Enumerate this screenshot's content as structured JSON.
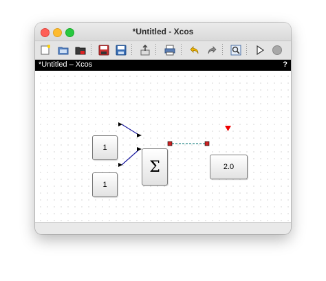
{
  "window": {
    "title": "*Untitled - Xcos"
  },
  "document": {
    "name": "*Untitled – Xcos",
    "help_label": "?"
  },
  "toolbar": {
    "buttons": [
      {
        "icon": "new-diagram-icon"
      },
      {
        "icon": "open-folder-icon"
      },
      {
        "icon": "open-file-icon"
      },
      {
        "icon": "save-icon"
      },
      {
        "icon": "save-as-icon"
      },
      {
        "icon": "export-icon"
      },
      {
        "icon": "print-icon"
      },
      {
        "icon": "undo-icon"
      },
      {
        "icon": "redo-icon"
      },
      {
        "icon": "zoom-fit-icon"
      },
      {
        "icon": "start-simulation-icon"
      },
      {
        "icon": "stop-simulation-icon"
      }
    ]
  },
  "diagram": {
    "blocks": {
      "const1": "1",
      "const2": "1",
      "sum": "Σ",
      "display": "2.0"
    }
  },
  "colors": {
    "data_link": "#1a1aa0",
    "activation_link": "#2a8a8a",
    "input_port": "#cc2222",
    "event_port": "#ee0000",
    "doc_header_bg": "#000000"
  }
}
